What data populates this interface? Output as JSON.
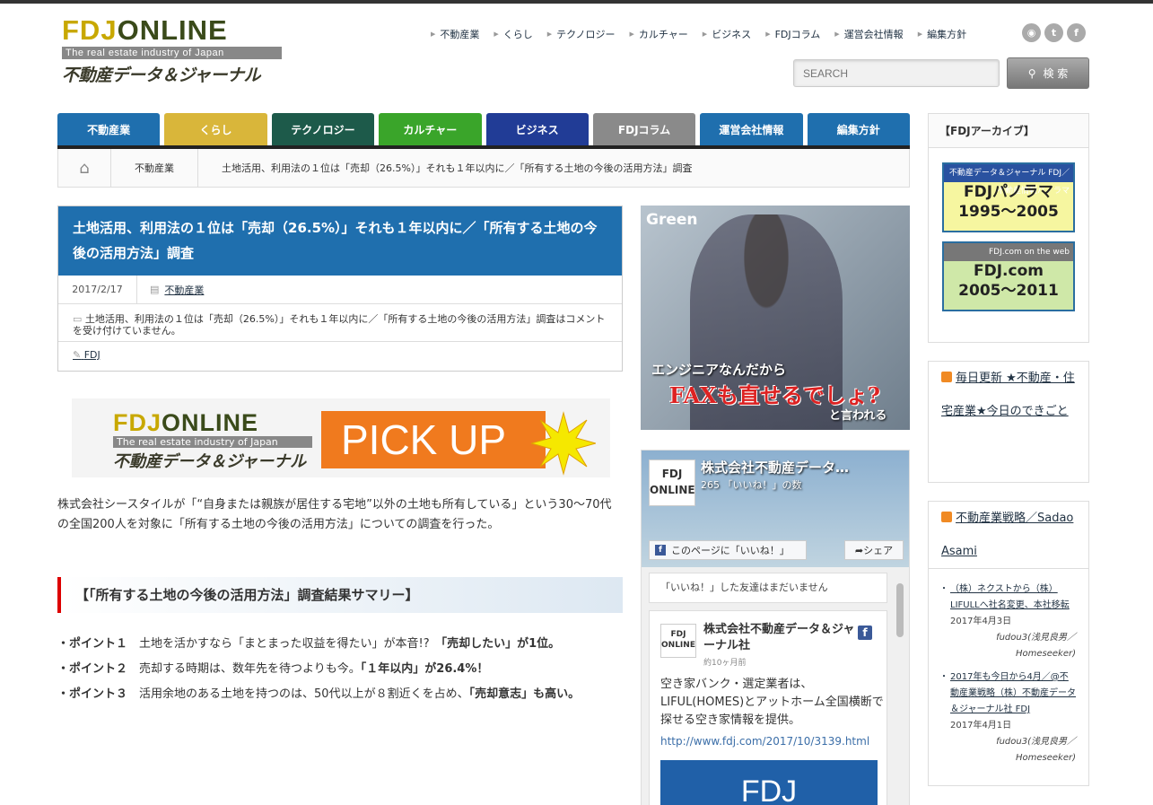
{
  "header": {
    "logo_fdj": "FDJ",
    "logo_online": "ONLINE",
    "logo_tagline": "The real estate industry of Japan",
    "logo_subtitle": "不動産データ＆ジャーナル",
    "top_links": [
      "不動産業",
      "くらし",
      "テクノロジー",
      "カルチャー",
      "ビジネス",
      "FDJコラム",
      "運営会社情報",
      "編集方針"
    ],
    "social": [
      "rss-icon",
      "twitter-icon",
      "facebook-icon"
    ],
    "search_placeholder": "SEARCH",
    "search_button": "検 索"
  },
  "mainnav": [
    {
      "label": "不動産業",
      "color": "#1f6fae"
    },
    {
      "label": "くらし",
      "color": "#d9b63a"
    },
    {
      "label": "テクノロジー",
      "color": "#1d5a4a"
    },
    {
      "label": "カルチャー",
      "color": "#3aa52a"
    },
    {
      "label": "ビジネス",
      "color": "#213c96"
    },
    {
      "label": "FDJコラム",
      "color": "#8a8a8a"
    },
    {
      "label": "運営会社情報",
      "color": "#1f6fae"
    },
    {
      "label": "編集方針",
      "color": "#1f6fae"
    }
  ],
  "breadcrumb": {
    "category": "不動産業",
    "current": "土地活用、利用法の１位は「売却（26.5%）」それも１年以内に／「所有する土地の今後の活用方法」調査"
  },
  "article": {
    "title": "土地活用、利用法の１位は「売却（26.5%）」それも１年以内に／「所有する土地の今後の活用方法」調査",
    "date": "2017/2/17",
    "category": "不動産業",
    "comment_note": "土地活用、利用法の１位は「売却（26.5%）」それも１年以内に／「所有する土地の今後の活用方法」調査はコメントを受け付けていません。",
    "author": "FDJ",
    "pickup_label": "PICK UP",
    "intro": "株式会社シースタイルが「“自身または親族が居住する宅地”以外の土地も所有している」という30〜70代の全国200人を対象に「所有する土地の今後の活用方法」についての調査を行った。",
    "summary_heading": "【「所有する土地の今後の活用方法」調査結果サマリー】",
    "points": [
      {
        "label": "・ポイント１",
        "text": "土地を活かすなら「まとまった収益を得たい」が本音!?",
        "highlight": "「売却したい」が1位。"
      },
      {
        "label": "・ポイント２",
        "text": "売却する時期は、数年先を待つよりも今。",
        "highlight": "「１年以内」が26.4%！"
      },
      {
        "label": "・ポイント３",
        "text": "活用余地のある土地を持つのは、50代以上が８割近くを占め、",
        "highlight": "「売却意志」も高い。"
      }
    ]
  },
  "ad": {
    "brand": "Green",
    "line1": "エンジニアなんだから",
    "line2": "FAXも直せるでしょ?",
    "line3": "と言われる"
  },
  "facebook": {
    "logo_line1": "FDJ",
    "logo_line2": "ONLINE",
    "page_name": "株式会社不動産データ…",
    "likes": "265 「いいね！」の数",
    "like_button": "このページに「いいね！」",
    "share_button": "シェア",
    "friends_note": "「いいね！」した友達はまだいません",
    "post_author": "株式会社不動産データ＆ジャーナル社",
    "post_time": "約10ヶ月前",
    "post_text": "空き家バンク・選定業者は、LIFUL(HOMES)とアットホーム全国横断で探せる空き家情報を提供。",
    "post_url": "http://www.fdj.com/2017/10/3139.html",
    "post_image_text": "FDJ"
  },
  "sidebar": {
    "archive_title": "【FDJアーカイブ】",
    "banner1_top": "不動産データ＆ジャーナル FDJ／不動産情報パノラマ",
    "banner1_line1": "FDJパノラマ",
    "banner1_line2": "1995〜2005",
    "banner2_top": "FDJ.com on the web",
    "banner2_line1": "FDJ.com",
    "banner2_line2": "2005〜2011",
    "feed1_title": "毎日更新 ★不動産・住宅産業★今日のできごと",
    "feed2_title": "不動産業戦略／Sadao Asami",
    "feed2_items": [
      {
        "title": "（株）ネクストから（株）LIFULLへ社名変更、本社移転",
        "date": "2017年4月3日",
        "author": "fudou3(浅見良男／Homeseeker)"
      },
      {
        "title": "2017年も今日から4月／@不動産業戦略（株）不動産データ＆ジャーナル社 FDJ",
        "date": "2017年4月1日",
        "author": "fudou3(浅見良男／Homeseeker)"
      }
    ]
  }
}
